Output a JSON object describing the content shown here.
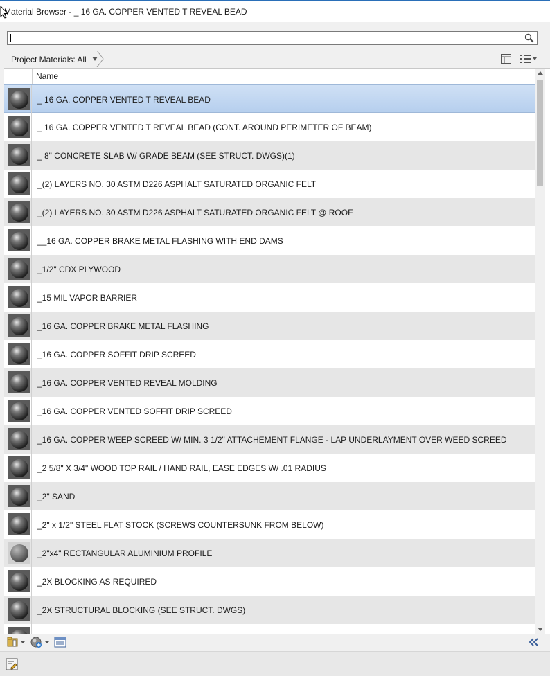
{
  "window": {
    "title": "Material Browser - _ 16 GA. COPPER VENTED T REVEAL BEAD"
  },
  "search": {
    "value": "",
    "placeholder": ""
  },
  "filter": {
    "label": "Project Materials: All"
  },
  "list": {
    "column_name": "Name",
    "items": [
      {
        "label": "_ 16 GA. COPPER VENTED T REVEAL BEAD",
        "selected": true,
        "swatch": "sphere-dark"
      },
      {
        "label": "_ 16 GA. COPPER VENTED T REVEAL BEAD (CONT. AROUND PERIMETER OF BEAM)",
        "swatch": "sphere-dark"
      },
      {
        "label": "_ 8\" CONCRETE SLAB W/ GRADE BEAM (SEE STRUCT. DWGS)(1)",
        "swatch": "sphere-dark"
      },
      {
        "label": "_(2) LAYERS NO. 30 ASTM D226 ASPHALT SATURATED ORGANIC FELT",
        "swatch": "sphere-dark"
      },
      {
        "label": "_(2) LAYERS NO. 30 ASTM D226 ASPHALT SATURATED ORGANIC FELT @ ROOF",
        "swatch": "sphere-dark"
      },
      {
        "label": "__16 GA. COPPER BRAKE METAL FLASHING WITH END DAMS",
        "swatch": "sphere-dark"
      },
      {
        "label": "_1/2\" CDX PLYWOOD",
        "swatch": "sphere-dark"
      },
      {
        "label": "_15 MIL VAPOR BARRIER",
        "swatch": "sphere-dark"
      },
      {
        "label": "_16 GA. COPPER BRAKE METAL FLASHING",
        "swatch": "sphere-dark"
      },
      {
        "label": "_16 GA. COPPER SOFFIT DRIP SCREED",
        "swatch": "sphere-dark"
      },
      {
        "label": "_16 GA. COPPER VENTED REVEAL MOLDING",
        "swatch": "sphere-dark"
      },
      {
        "label": "_16 GA. COPPER VENTED SOFFIT DRIP SCREED",
        "swatch": "sphere-dark"
      },
      {
        "label": "_16 GA. COPPER WEEP SCREED W/ MIN. 3 1/2\" ATTACHEMENT FLANGE - LAP UNDERLAYMENT OVER WEED SCREED",
        "swatch": "sphere-dark"
      },
      {
        "label": "_2 5/8\" X 3/4\" WOOD TOP RAIL / HAND RAIL, EASE EDGES W/ .01 RADIUS",
        "swatch": "sphere-dark"
      },
      {
        "label": "_2\" SAND",
        "swatch": "sphere-dark"
      },
      {
        "label": "_2\" x 1/2\" STEEL FLAT STOCK (SCREWS COUNTERSUNK FROM BELOW)",
        "swatch": "sphere-dark"
      },
      {
        "label": "_2\"x4\" RECTANGULAR ALUMINIUM PROFILE",
        "swatch": "sphere-matte"
      },
      {
        "label": "_2X BLOCKING AS REQUIRED",
        "swatch": "sphere-dark"
      },
      {
        "label": "_2X STRUCTURAL BLOCKING (SEE STRUCT. DWGS)",
        "swatch": "sphere-dark"
      },
      {
        "label": "",
        "swatch": "sphere-dark"
      }
    ]
  },
  "colors": {
    "selected_row": "#b6cfee",
    "alt_row": "#e6e6e6",
    "title_accent": "#2a6fb8"
  },
  "icons": {
    "search": "magnifier-icon",
    "view_toggle": "panel-layout-icon",
    "list_view": "list-view-icon",
    "library": "library-icon",
    "create_material": "create-material-icon",
    "material_editor": "material-editor-toggle-icon",
    "collapse": "double-chevron-left-icon",
    "status": "edit-material-icon"
  }
}
